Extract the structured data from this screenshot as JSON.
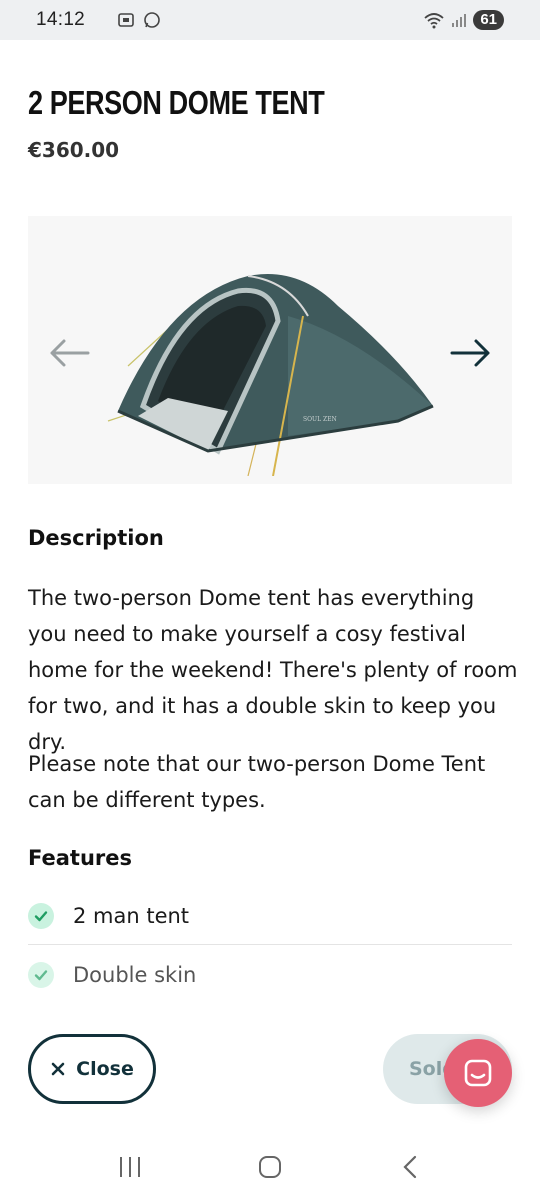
{
  "status": {
    "time": "14:12",
    "battery": "61"
  },
  "product": {
    "title": "2 PERSON DOME TENT",
    "price": "€360.00"
  },
  "description": {
    "heading": "Description",
    "paragraph1": "The two-person Dome tent has everything you need to make yourself a cosy festival home for the weekend! There's plenty of room for two, and it has a double skin to keep you dry.",
    "paragraph2": "Please note that our two-person Dome Tent can be different types."
  },
  "features": {
    "heading": "Features",
    "items": [
      {
        "label": "2 man tent"
      },
      {
        "label": "Double skin"
      }
    ]
  },
  "actions": {
    "close_label": "Close",
    "sold_label": "Sold"
  },
  "icons": {
    "prev": "arrow-left-icon",
    "next": "arrow-right-icon",
    "check": "check-icon",
    "close": "close-icon",
    "chat": "chat-icon"
  },
  "colors": {
    "accent_dark": "#12313a",
    "check_bg": "#c9f2df",
    "check_mark": "#1f9d62",
    "chat": "#e56075",
    "sold_bg": "#dfe9ea"
  }
}
